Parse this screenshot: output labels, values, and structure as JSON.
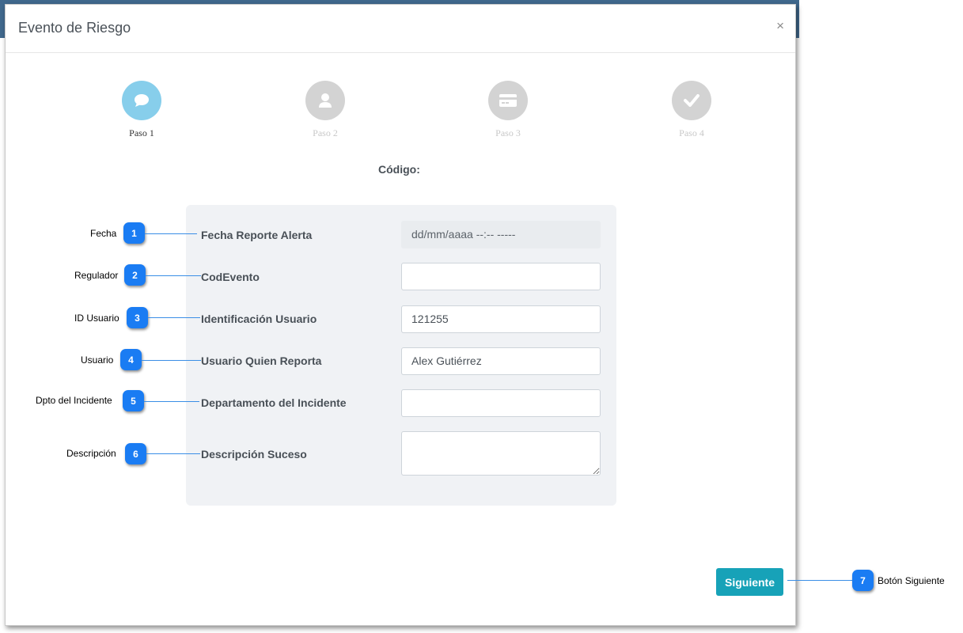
{
  "modal": {
    "title": "Evento de Riesgo",
    "close_label": "×"
  },
  "steps": [
    {
      "label": "Paso 1",
      "icon": "chat-icon",
      "active": true
    },
    {
      "label": "Paso 2",
      "icon": "user-icon",
      "active": false
    },
    {
      "label": "Paso 3",
      "icon": "credit-card-icon",
      "active": false
    },
    {
      "label": "Paso 4",
      "icon": "check-icon",
      "active": false
    }
  ],
  "form": {
    "codigo_label": "Código:",
    "fields": [
      {
        "label": "Fecha Reporte Alerta",
        "value": "dd/mm/aaaa  --:--  -----",
        "disabled": true
      },
      {
        "label": "CodEvento",
        "value": ""
      },
      {
        "label": "Identificación Usuario",
        "value": "121255"
      },
      {
        "label": "Usuario Quien Reporta",
        "value": "Alex Gutiérrez"
      },
      {
        "label": "Departamento del Incidente",
        "value": ""
      },
      {
        "label": "Descripción Suceso",
        "value": ""
      }
    ],
    "next_label": "Siguiente"
  },
  "callouts": [
    {
      "number": "1",
      "text": "Fecha"
    },
    {
      "number": "2",
      "text": "Regulador"
    },
    {
      "number": "3",
      "text": "ID Usuario"
    },
    {
      "number": "4",
      "text": "Usuario"
    },
    {
      "number": "5",
      "text": "Dpto del Incidente"
    },
    {
      "number": "6",
      "text": "Descripción"
    },
    {
      "number": "7",
      "text": "Botón Siguiente"
    }
  ],
  "colors": {
    "active_step": "#87ceeb",
    "inactive_step": "#d3d3d3",
    "primary_button": "#17a2b8",
    "callout_badge": "#1a7cf3"
  }
}
